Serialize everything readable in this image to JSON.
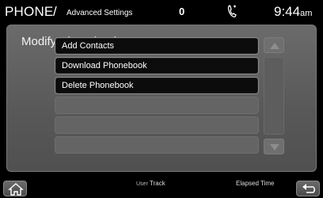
{
  "header": {
    "title": "PHONE",
    "separator": "/",
    "subtitle": "Advanced Settings",
    "indicator_value": "0",
    "clock": "9:44",
    "clock_ampm": "am"
  },
  "panel": {
    "title": "Modify Phonebook",
    "items": [
      {
        "label": "Add Contacts"
      },
      {
        "label": "Download Phonebook"
      },
      {
        "label": "Delete Phonebook"
      },
      {
        "label": ""
      },
      {
        "label": ""
      },
      {
        "label": ""
      }
    ]
  },
  "footer": {
    "user_label": "User",
    "track_label": "Track",
    "elapsed_label": "Elapsed Time"
  },
  "icons": {
    "phone": "phone-icon",
    "home": "home-icon",
    "back": "back-arrow-icon",
    "up": "chevron-up-icon",
    "down": "chevron-down-icon"
  }
}
